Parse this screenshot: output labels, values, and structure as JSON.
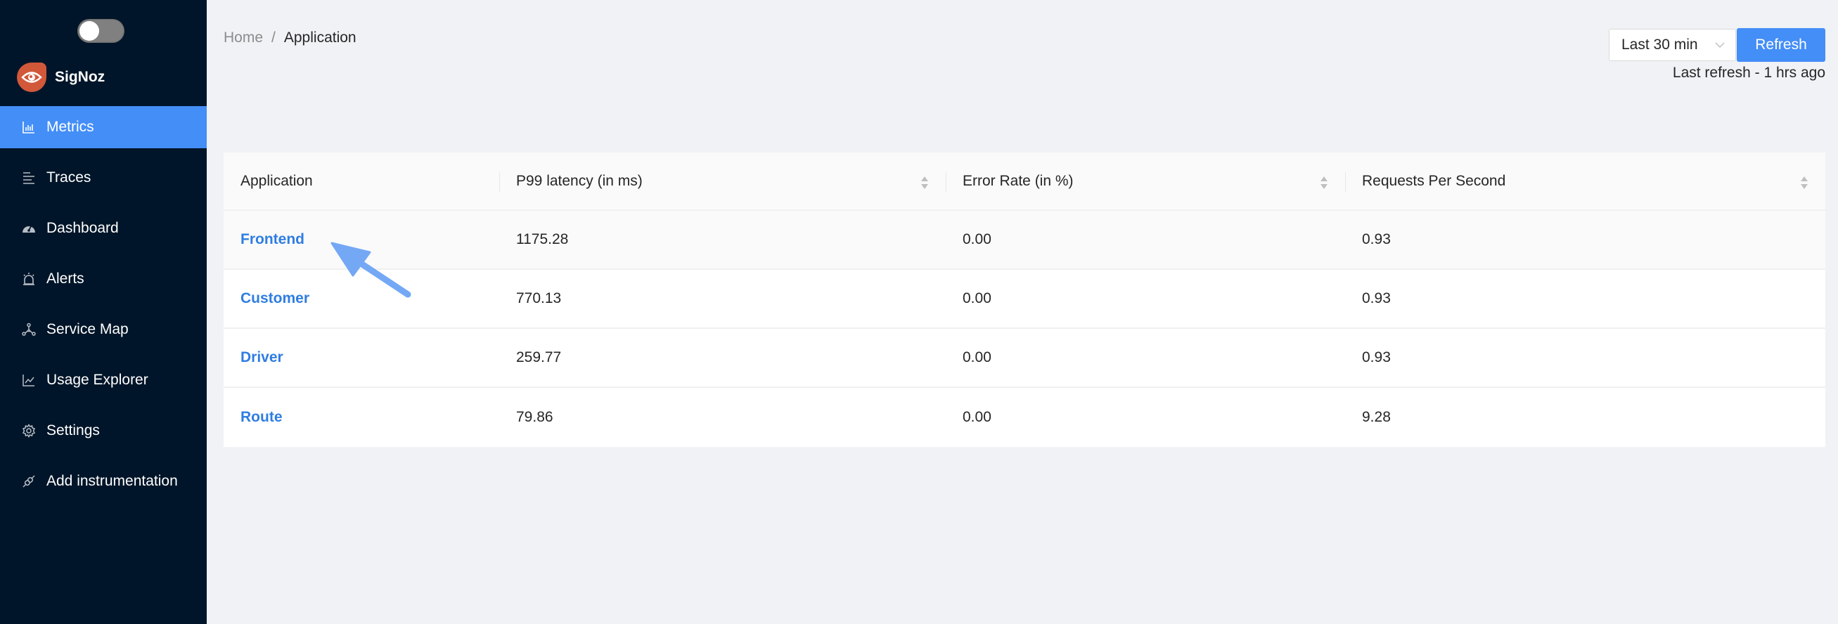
{
  "sidebar": {
    "brand": "SigNoz",
    "theme_toggle": "off",
    "items": [
      {
        "label": "Metrics",
        "icon": "bar-chart-icon",
        "active": true
      },
      {
        "label": "Traces",
        "icon": "bars-icon",
        "active": false
      },
      {
        "label": "Dashboard",
        "icon": "dashboard-icon",
        "active": false
      },
      {
        "label": "Alerts",
        "icon": "alert-icon",
        "active": false
      },
      {
        "label": "Service Map",
        "icon": "deployment-unit-icon",
        "active": false
      },
      {
        "label": "Usage Explorer",
        "icon": "line-chart-icon",
        "active": false
      },
      {
        "label": "Settings",
        "icon": "gear-icon",
        "active": false
      },
      {
        "label": "Add instrumentation",
        "icon": "api-plug-icon",
        "active": false
      }
    ]
  },
  "header": {
    "breadcrumb": {
      "home": "Home",
      "separator": "/",
      "current": "Application"
    },
    "time_range": "Last 30 min",
    "refresh_label": "Refresh",
    "last_refresh": "Last refresh - 1 hrs ago"
  },
  "table": {
    "columns": [
      "Application",
      "P99 latency (in ms)",
      "Error Rate (in %)",
      "Requests Per Second"
    ],
    "rows": [
      {
        "application": "Frontend",
        "p99": "1175.28",
        "error_rate": "0.00",
        "rps": "0.93"
      },
      {
        "application": "Customer",
        "p99": "770.13",
        "error_rate": "0.00",
        "rps": "0.93"
      },
      {
        "application": "Driver",
        "p99": "259.77",
        "error_rate": "0.00",
        "rps": "0.93"
      },
      {
        "application": "Route",
        "p99": "79.86",
        "error_rate": "0.00",
        "rps": "9.28"
      }
    ]
  },
  "colors": {
    "sidebar_bg": "#001529",
    "accent": "#448ef7",
    "link": "#2f7de1",
    "brand_logo": "#d2583a",
    "annotation_arrow": "#74a8f5"
  }
}
